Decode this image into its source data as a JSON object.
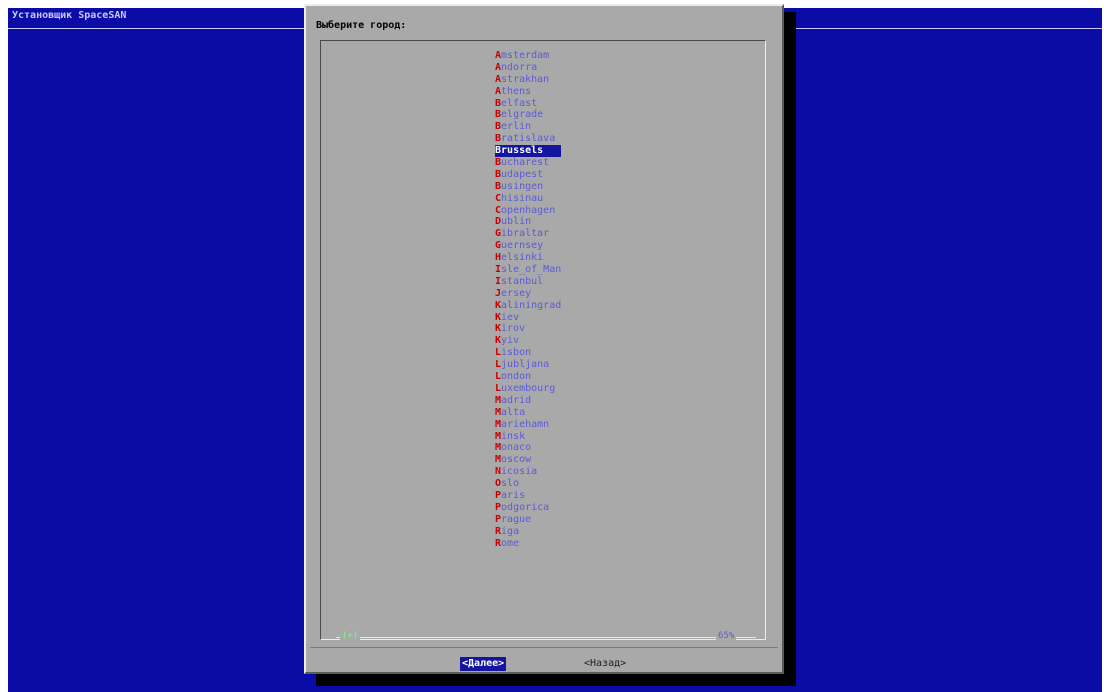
{
  "app": {
    "title": "Установщик SpaceSAN"
  },
  "dialog": {
    "title": "Выберите город:",
    "selected_index": 9,
    "cities": [
      "Amsterdam",
      "Andorra",
      "Astrakhan",
      "Athens",
      "Belfast",
      "Belgrade",
      "Berlin",
      "Bratislava",
      "Brussels",
      "Bucharest",
      "Budapest",
      "Busingen",
      "Chisinau",
      "Copenhagen",
      "Dublin",
      "Gibraltar",
      "Guernsey",
      "Helsinki",
      "Isle_of_Man",
      "Istanbul",
      "Jersey",
      "Kaliningrad",
      "Kiev",
      "Kirov",
      "Kyiv",
      "Lisbon",
      "Ljubljana",
      "London",
      "Luxembourg",
      "Madrid",
      "Malta",
      "Mariehamn",
      "Minsk",
      "Monaco",
      "Moscow",
      "Nicosia",
      "Oslo",
      "Paris",
      "Podgorica",
      "Prague",
      "Riga",
      "Rome"
    ],
    "scroll": {
      "left": "(+)",
      "right": "65%"
    },
    "buttons": {
      "next": "<Далее>",
      "back": "<Назад>"
    }
  },
  "colors": {
    "background": "#0b0ba6",
    "dialog": "#a9a9a9",
    "hotkey": "#c80000",
    "item_text": "#5b5bd6",
    "selection": "#1414a0"
  }
}
